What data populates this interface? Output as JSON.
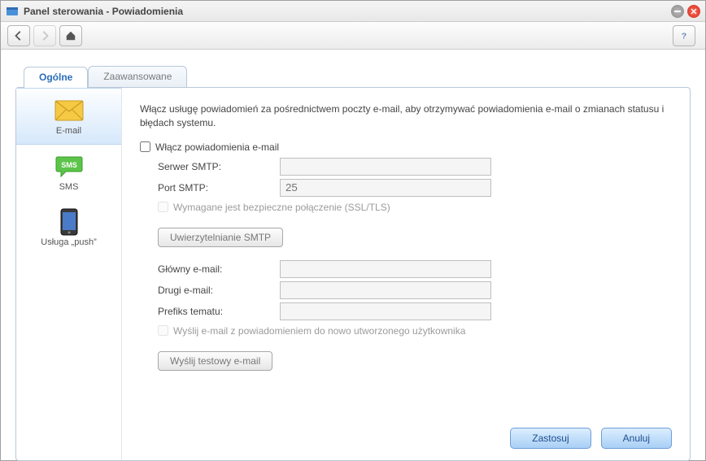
{
  "window": {
    "title": "Panel sterowania - Powiadomienia"
  },
  "tabs": {
    "general": "Ogólne",
    "advanced": "Zaawansowane"
  },
  "sidebar": {
    "email": "E-mail",
    "sms": "SMS",
    "push": "Usługa „push”"
  },
  "main": {
    "intro": "Włącz usługę powiadomień za pośrednictwem poczty e-mail, aby otrzymywać powiadomienia e-mail o zmianach statusu i błędach systemu.",
    "enable_email": "Włącz powiadomienia e-mail",
    "smtp_server_label": "Serwer SMTP:",
    "smtp_server_value": "",
    "smtp_port_label": "Port SMTP:",
    "smtp_port_placeholder": "25",
    "ssl_label": "Wymagane jest bezpieczne połączenie (SSL/TLS)",
    "smtp_auth_btn": "Uwierzytelnianie SMTP",
    "primary_email_label": "Główny e-mail:",
    "primary_email_value": "",
    "second_email_label": "Drugi e-mail:",
    "second_email_value": "",
    "prefix_label": "Prefiks tematu:",
    "prefix_value": "",
    "send_new_user_label": "Wyślij e-mail z powiadomieniem do nowo utworzonego użytkownika",
    "test_btn": "Wyślij testowy e-mail"
  },
  "footer": {
    "apply": "Zastosuj",
    "cancel": "Anuluj"
  }
}
